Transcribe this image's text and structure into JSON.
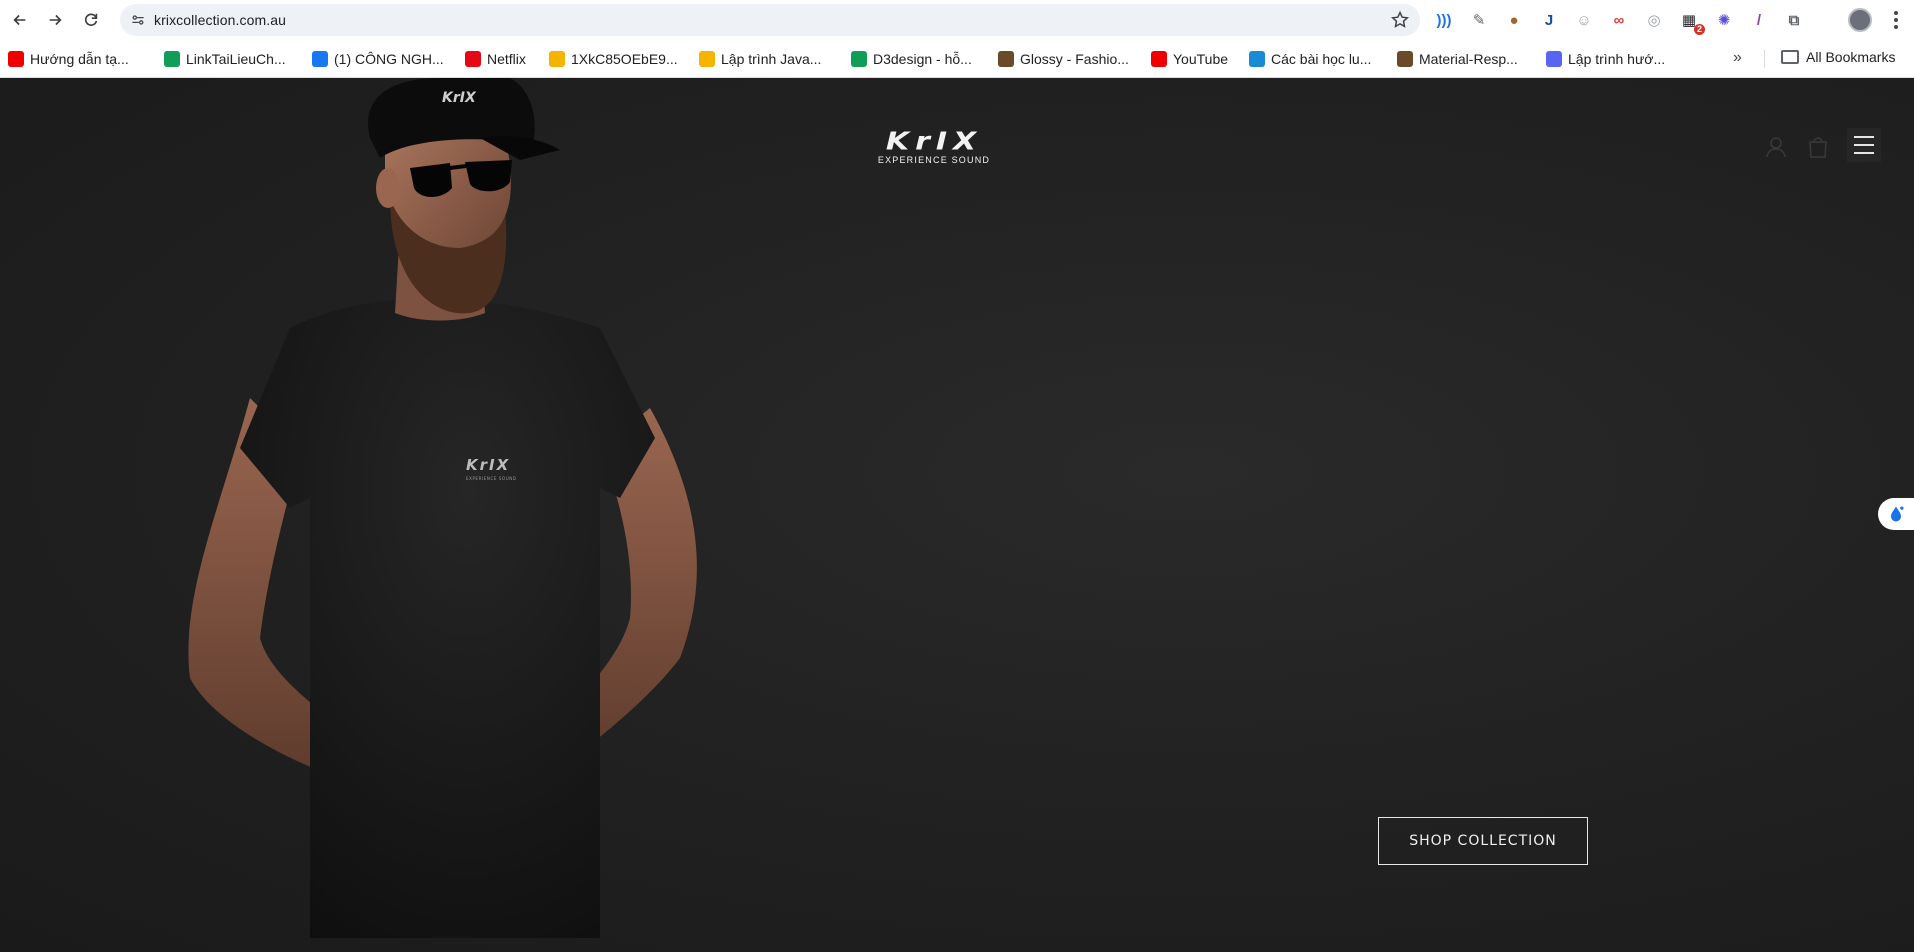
{
  "browser": {
    "url": "krixcollection.com.au",
    "extensions": [
      {
        "name": "ext-waves-icon",
        "color": "#1a73e8",
        "glyph": ")))"
      },
      {
        "name": "ext-eyedropper-icon",
        "color": "#5f6368",
        "glyph": "✎"
      },
      {
        "name": "ext-cookie-icon",
        "color": "#a0672a",
        "glyph": "●"
      },
      {
        "name": "ext-j-icon",
        "color": "#1a4fa0",
        "glyph": "J"
      },
      {
        "name": "ext-face-icon",
        "color": "#9aa0a6",
        "glyph": "☺"
      },
      {
        "name": "ext-infinity-icon",
        "color": "#e53935",
        "glyph": "∞"
      },
      {
        "name": "ext-compass-icon",
        "color": "#9aa0a6",
        "glyph": "◎"
      },
      {
        "name": "ext-calendar-icon",
        "color": "#202124",
        "glyph": "▦",
        "badge": "2"
      },
      {
        "name": "ext-gear-icon",
        "color": "#5b4bd6",
        "glyph": "✺"
      },
      {
        "name": "ext-pen-icon",
        "color": "#8e44ad",
        "glyph": "/"
      },
      {
        "name": "extensions-puzzle-icon",
        "color": "#5f6368",
        "glyph": "⧉"
      }
    ]
  },
  "bookmarks": {
    "items": [
      {
        "label": "Hướng dẫn tạ...",
        "icon": "youtube-icon",
        "color": "#e00"
      },
      {
        "label": "LinkTaiLieuCh...",
        "icon": "sheets-icon",
        "color": "#0f9d58"
      },
      {
        "label": "(1) CÔNG NGH...",
        "icon": "facebook-icon",
        "color": "#1877f2"
      },
      {
        "label": "Netflix",
        "icon": "netflix-icon",
        "color": "#e50914"
      },
      {
        "label": "1XkC85OEbE9...",
        "icon": "drive-icon",
        "color": "#f4b400"
      },
      {
        "label": "Lập trình Java...",
        "icon": "drive-icon",
        "color": "#f4b400"
      },
      {
        "label": "D3design - hỗ...",
        "icon": "sheets-icon",
        "color": "#0f9d58"
      },
      {
        "label": "Glossy - Fashio...",
        "icon": "site-icon",
        "color": "#6b4a2a"
      },
      {
        "label": "YouTube",
        "icon": "youtube-icon",
        "color": "#e00"
      },
      {
        "label": "Các bài học lu...",
        "icon": "ts-icon",
        "color": "#1a8ad4"
      },
      {
        "label": "Material-Resp...",
        "icon": "site-icon",
        "color": "#6b4a2a"
      },
      {
        "label": "Lập trình hướ...",
        "icon": "discord-icon",
        "color": "#5865f2"
      }
    ],
    "overflow": "»",
    "all_bookmarks": "All Bookmarks"
  },
  "site": {
    "logo_word": "KrIX",
    "logo_tagline": "EXPERIENCE SOUND",
    "shirt_logo": "KrIX",
    "cap_logo": "KrIX",
    "cta_label": "SHOP COLLECTION"
  }
}
